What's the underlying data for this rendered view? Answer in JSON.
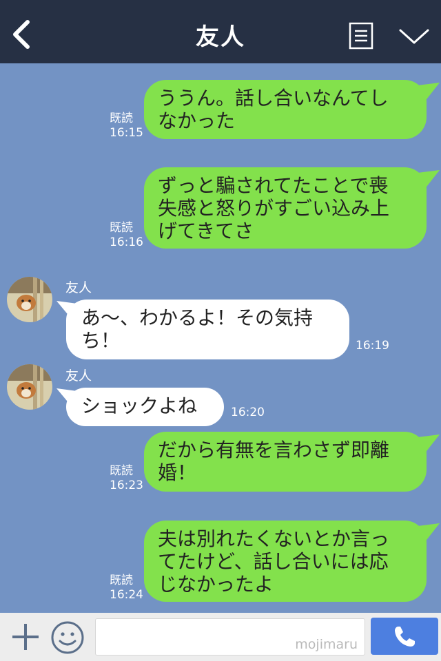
{
  "header": {
    "title": "友人",
    "back_icon": "chevron-left-icon",
    "menu_icon": "note-icon",
    "more_icon": "chevron-down-icon"
  },
  "messages": [
    {
      "side": "out",
      "lines": [
        "ううん。話し合いなんてし",
        "なかった"
      ],
      "read": "既読",
      "time": "16:15"
    },
    {
      "side": "out",
      "lines": [
        "ずっと騙されてたことで喪",
        "失感と怒りがすごい込み上",
        "げてきてさ"
      ],
      "read": "既読",
      "time": "16:16"
    },
    {
      "side": "in",
      "sender": "友人",
      "lines": [
        "あ〜、わかるよ！その気持",
        "ち！"
      ],
      "time": "16:19"
    },
    {
      "side": "in",
      "sender": "友人",
      "lines": [
        "ショックよね"
      ],
      "time": "16:20"
    },
    {
      "side": "out",
      "lines": [
        "だから有無を言わさず即離",
        "婚！"
      ],
      "read": "既読",
      "time": "16:23"
    },
    {
      "side": "out",
      "lines": [
        "夫は別れたくないとか言っ",
        "てたけど、話し合いには応",
        "じなかったよ"
      ],
      "read": "既読",
      "time": "16:24"
    }
  ],
  "footer": {
    "watermark": "mojimaru",
    "plus_icon": "plus-icon",
    "emoji_icon": "smiley-icon",
    "call_icon": "phone-icon"
  },
  "colors": {
    "header": "#263044",
    "chat_bg": "#7393c4",
    "outgoing": "#83e14c",
    "incoming": "#ffffff",
    "call_button": "#4d7fe0"
  }
}
